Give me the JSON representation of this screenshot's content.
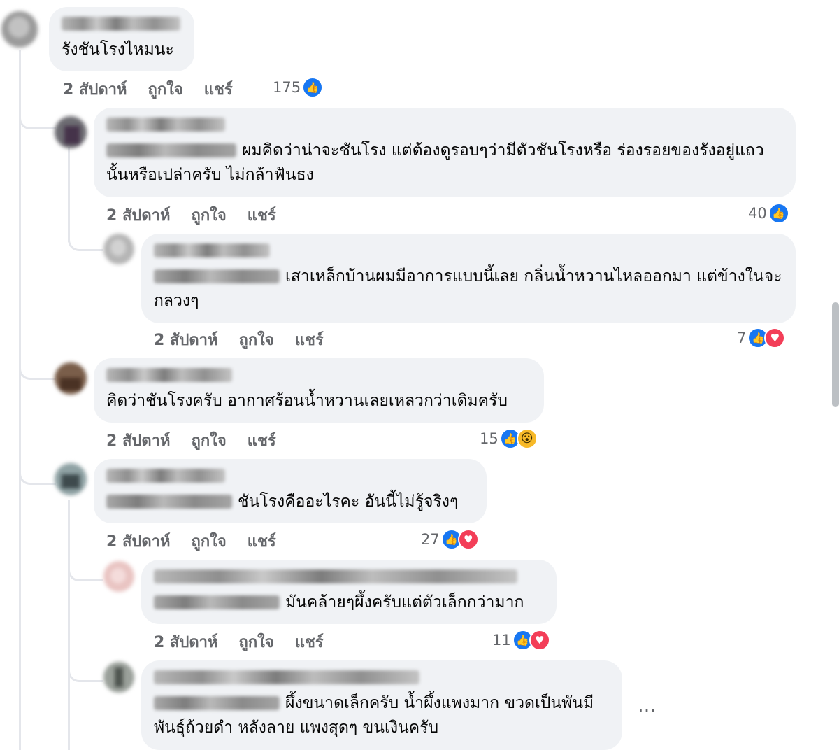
{
  "comments": [
    {
      "text": "รังชันโรงไหมนะ",
      "time": "2 สัปดาห์",
      "like": "ถูกใจ",
      "share": "แชร์",
      "count": "175"
    },
    {
      "text": "ผมคิดว่าน่าจะชันโรง แต่ต้องดูรอบๆว่ามีตัวชันโรงหรือ ร่องรอยของรังอยู่แถวนั้นหรือเปล่าครับ ไม่กล้าฟันธง",
      "time": "2 สัปดาห์",
      "like": "ถูกใจ",
      "share": "แชร์",
      "count": "40"
    },
    {
      "text": "เสาเหล็กบ้านผมมีอาการแบบนี้เลย กลิ่นน้ำหวานไหลออกมา แต่ข้างในจะกลวงๆ",
      "time": "2 สัปดาห์",
      "like": "ถูกใจ",
      "share": "แชร์",
      "count": "7"
    },
    {
      "text": "คิดว่าชันโรงครับ อากาศร้อนน้ำหวานเลยเหลวกว่าเดิมครับ",
      "time": "2 สัปดาห์",
      "like": "ถูกใจ",
      "share": "แชร์",
      "count": "15"
    },
    {
      "text": "ชันโรงคืออะไรคะ อันนี้ไม่รู้จริงๆ",
      "time": "2 สัปดาห์",
      "like": "ถูกใจ",
      "share": "แชร์",
      "count": "27"
    },
    {
      "text": "มันคล้ายๆผึ้งครับแต่ตัวเล็กกว่ามาก",
      "time": "2 สัปดาห์",
      "like": "ถูกใจ",
      "share": "แชร์",
      "count": "11"
    },
    {
      "text": "ผึ้งขนาดเล็กครับ น้ำผึ้งแพงมาก ขวดเป็นพันมีพันธุ์ถ้วยดำ หลังลาย แพงสุดๆ ขนเงินครับ"
    }
  ],
  "more_label": "…",
  "icons": {
    "like": "like-reaction-icon",
    "love": "love-reaction-icon",
    "wow": "wow-reaction-icon"
  },
  "colors": {
    "like": "#1877f2",
    "love": "#f33e58",
    "wow": "#f7b928",
    "bubble": "#f0f2f5",
    "meta": "#65676b"
  }
}
